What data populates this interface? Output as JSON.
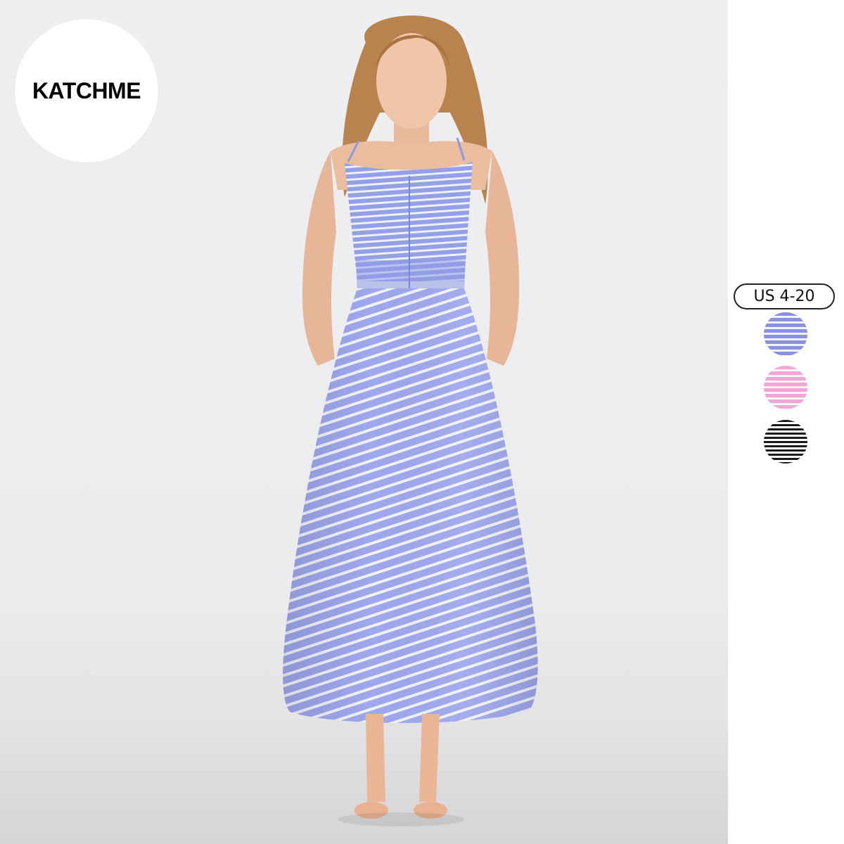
{
  "brand": {
    "logo_text": "KATCHME"
  },
  "product": {
    "size_range": "US 4-20",
    "color_options": [
      {
        "name": "blue-stripe-swatch",
        "color": "#8b8fe0"
      },
      {
        "name": "pink-stripe-swatch",
        "color": "#f1a6d6"
      },
      {
        "name": "black-stripe-swatch",
        "color": "#1a1a1a"
      }
    ]
  },
  "colors": {
    "dress_blue": "#9aa6ea",
    "backdrop": "#eeeff1"
  }
}
